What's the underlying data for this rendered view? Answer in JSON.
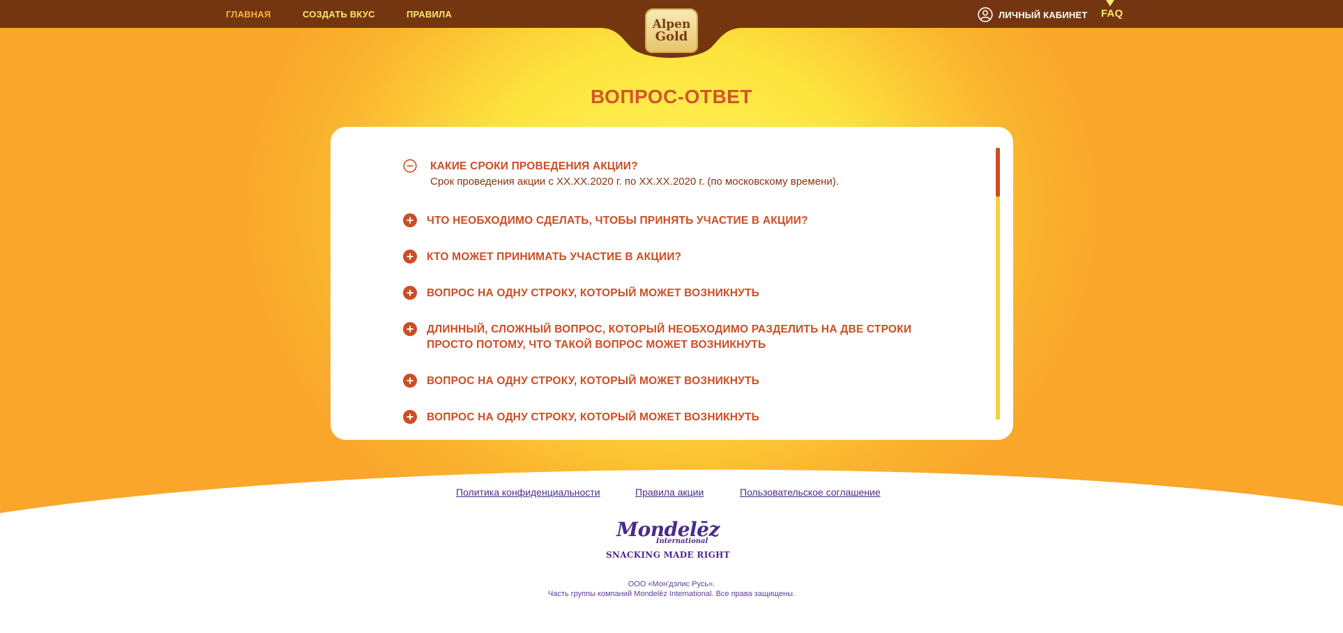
{
  "header": {
    "nav": {
      "home": "ГЛАВНАЯ",
      "create": "СОЗДАТЬ ВКУС",
      "rules": "ПРАВИЛА"
    },
    "logo": {
      "line1": "Alpen",
      "line2": "Gold"
    },
    "cabinet_label": "ЛИЧНЫЙ КАБИНЕТ",
    "faq_label": "FAQ"
  },
  "main": {
    "title": "ВОПРОС-ОТВЕТ",
    "faq_items": [
      {
        "question": "КАКИЕ СРОКИ ПРОВЕДЕНИЯ АКЦИИ?",
        "answer": "Срок проведения акции с XX.XX.2020 г. по XX.XX.2020 г. (по московскому времени).",
        "expanded": true
      },
      {
        "question": "ЧТО НЕОБХОДИМО СДЕЛАТЬ, ЧТОБЫ ПРИНЯТЬ УЧАСТИЕ В АКЦИИ?",
        "expanded": false
      },
      {
        "question": "КТО МОЖЕТ ПРИНИМАТЬ УЧАСТИЕ В АКЦИИ?",
        "expanded": false
      },
      {
        "question": "ВОПРОС НА ОДНУ СТРОКУ, КОТОРЫЙ МОЖЕТ ВОЗНИКНУТЬ",
        "expanded": false
      },
      {
        "question": "ДЛИННЫЙ, СЛОЖНЫЙ ВОПРОС, КОТОРЫЙ НЕОБХОДИМО РАЗДЕЛИТЬ НА ДВЕ СТРОКИ ПРОСТО ПОТОМУ, ЧТО ТАКОЙ ВОПРОС МОЖЕТ ВОЗНИКНУТЬ",
        "expanded": false
      },
      {
        "question": "ВОПРОС НА ОДНУ СТРОКУ, КОТОРЫЙ МОЖЕТ ВОЗНИКНУТЬ",
        "expanded": false
      },
      {
        "question": "ВОПРОС НА ОДНУ СТРОКУ, КОТОРЫЙ МОЖЕТ ВОЗНИКНУТЬ",
        "expanded": false
      }
    ]
  },
  "footer": {
    "links": {
      "privacy": "Политика конфиденциальности",
      "rules": "Правила акции",
      "agreement": "Пользовательское соглашение"
    },
    "brand": {
      "name": "Mondelēz",
      "sub": "International",
      "tagline": "SNACKING MADE RIGHT"
    },
    "copyright_line1": "ООО «Мон'дэлис Русь».",
    "copyright_line2": "Часть группы компаний Mondelēz International. Все права защищены."
  },
  "colors": {
    "header_bg": "#743610",
    "accent": "#cd4d24",
    "footer_text": "#4b2b8a"
  },
  "icons": {
    "expanded": "minus-circle-icon",
    "collapsed": "plus-circle-icon",
    "user": "user-icon"
  }
}
